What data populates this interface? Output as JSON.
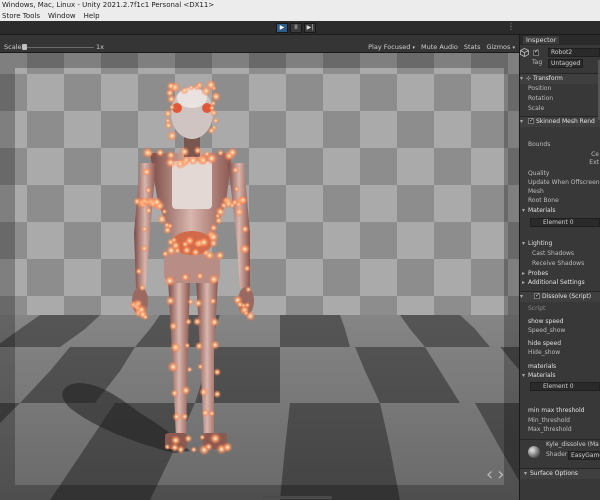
{
  "window": {
    "title": "Windows, Mac, Linux - Unity 2021.2.7f1c1 Personal <DX11>"
  },
  "menu": [
    "Store Tools",
    "Window",
    "Help"
  ],
  "toolbar": {
    "play_icon": "▶",
    "pause_icon": "II",
    "step_icon": "▶|",
    "more_icon": "⋮"
  },
  "game_view": {
    "scale_label": "Scale",
    "scale_value": "1x",
    "play_focused": "Play Focused",
    "mute_audio": "Mute Audio",
    "stats": "Stats",
    "gizmos": "Gizmos",
    "dropdown_arrow": "▾",
    "prev_icon": "‹",
    "next_icon": "›"
  },
  "inspector": {
    "tab_label": "Inspector",
    "object_name": "Robot2",
    "tag_label": "Tag",
    "tag_value": "Untagged",
    "transform": {
      "title": "Transform",
      "fields": [
        "Position",
        "Rotation",
        "Scale"
      ]
    },
    "skinned_mesh": {
      "title": "Skinned Mesh Rend",
      "bounds": "Bounds",
      "bounds_sub": [
        "Ce",
        "Ext"
      ],
      "fields": [
        "Quality",
        "Update When Offscreen",
        "Mesh",
        "Root Bone"
      ],
      "materials": "Materials",
      "element": "Element 0",
      "lighting": "Lighting",
      "lighting_fields": [
        "Cast Shadows",
        "Receive Shadows"
      ],
      "probes": "Probes",
      "additional": "Additional Settings"
    },
    "dissolve": {
      "title": "Dissolve (Script)",
      "script_label": "Script",
      "show_speed_title": "show speed",
      "show_speed_field": "Speed_show",
      "hide_speed_title": "hide speed",
      "hide_speed_field": "Hide_show",
      "materials_title": "materials",
      "materials_label": "Materials",
      "element": "Element 0",
      "threshold_title": "min max threshold",
      "min_threshold": "Min_threshold",
      "max_threshold": "Max_threshold"
    },
    "material": {
      "name": "Kyle_dissolve (Ma",
      "shader_label": "Shader",
      "shader_value": "EasyGame",
      "surface_options": "Surface Options"
    }
  }
}
